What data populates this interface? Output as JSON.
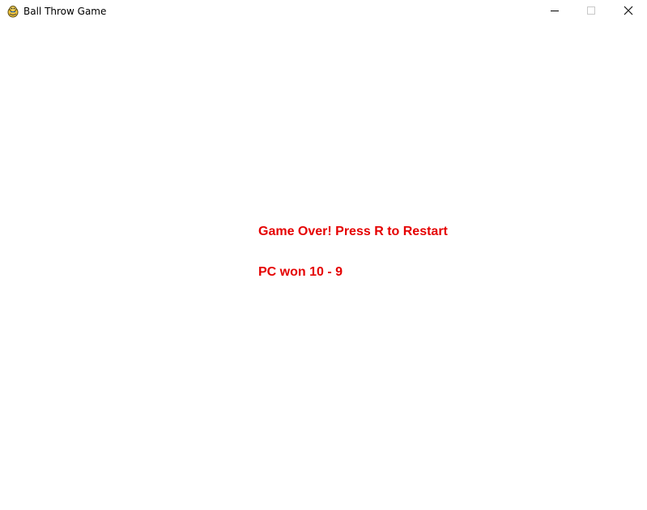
{
  "window": {
    "title": "Ball Throw Game",
    "app_icon": "pygame-snake-icon",
    "controls": {
      "minimize_icon": "minimize-icon",
      "maximize_icon": "maximize-icon",
      "close_icon": "close-icon"
    }
  },
  "game": {
    "background_color": "#ffffff",
    "text_color": "#e50000",
    "game_over_message": "Game Over! Press R to Restart",
    "result_message": "PC won 10 - 9"
  }
}
